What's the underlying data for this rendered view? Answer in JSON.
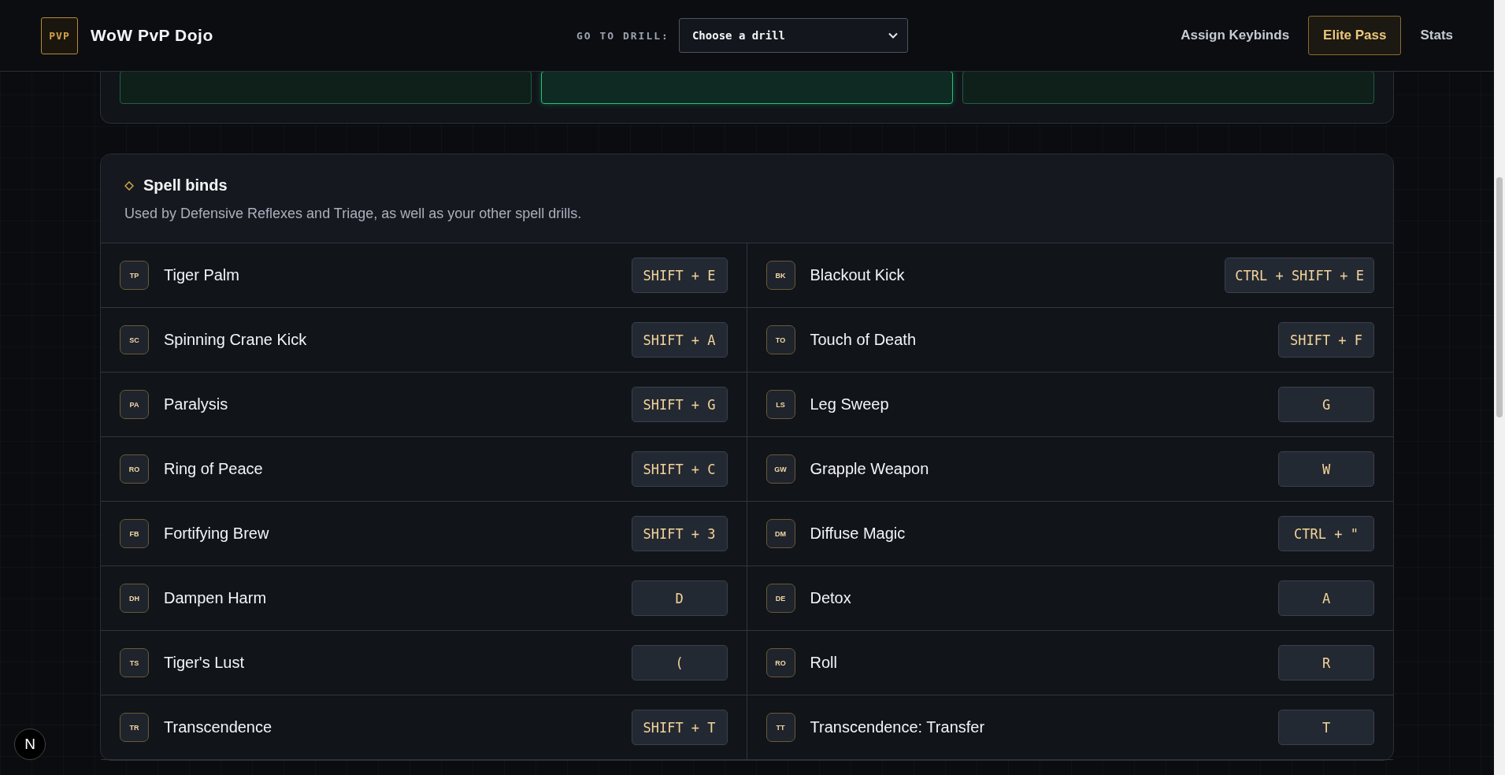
{
  "header": {
    "logo": "PVP",
    "title": "WoW PvP Dojo",
    "drill_label": "GO TO DRILL:",
    "drill_select": "Choose a drill",
    "nav": [
      {
        "label": "Assign Keybinds",
        "kind": "link"
      },
      {
        "label": "Elite Pass",
        "kind": "button"
      },
      {
        "label": "Stats",
        "kind": "link"
      }
    ]
  },
  "role_cards": [
    {
      "selected": false
    },
    {
      "selected": true
    },
    {
      "selected": false
    }
  ],
  "spell_binds": {
    "title": "Spell binds",
    "description": "Used by Defensive Reflexes and Triage, as well as your other spell drills.",
    "spells": [
      {
        "abbr": "TP",
        "name": "Tiger Palm",
        "key": "SHIFT + E"
      },
      {
        "abbr": "BK",
        "name": "Blackout Kick",
        "key": "CTRL + SHIFT + E"
      },
      {
        "abbr": "SC",
        "name": "Spinning Crane Kick",
        "key": "SHIFT + A"
      },
      {
        "abbr": "TO",
        "name": "Touch of Death",
        "key": "SHIFT + F"
      },
      {
        "abbr": "PA",
        "name": "Paralysis",
        "key": "SHIFT + G"
      },
      {
        "abbr": "LS",
        "name": "Leg Sweep",
        "key": "G"
      },
      {
        "abbr": "RO",
        "name": "Ring of Peace",
        "key": "SHIFT + C"
      },
      {
        "abbr": "GW",
        "name": "Grapple Weapon",
        "key": "W"
      },
      {
        "abbr": "FB",
        "name": "Fortifying Brew",
        "key": "SHIFT + 3"
      },
      {
        "abbr": "DM",
        "name": "Diffuse Magic",
        "key": "CTRL + \""
      },
      {
        "abbr": "DH",
        "name": "Dampen Harm",
        "key": "D"
      },
      {
        "abbr": "DE",
        "name": "Detox",
        "key": "A"
      },
      {
        "abbr": "TS",
        "name": "Tiger's Lust",
        "key": "("
      },
      {
        "abbr": "RO",
        "name": "Roll",
        "key": "R"
      },
      {
        "abbr": "TR",
        "name": "Transcendence",
        "key": "SHIFT + T"
      },
      {
        "abbr": "TT",
        "name": "Transcendence: Transfer",
        "key": "T"
      }
    ]
  },
  "dev_badge": "N"
}
